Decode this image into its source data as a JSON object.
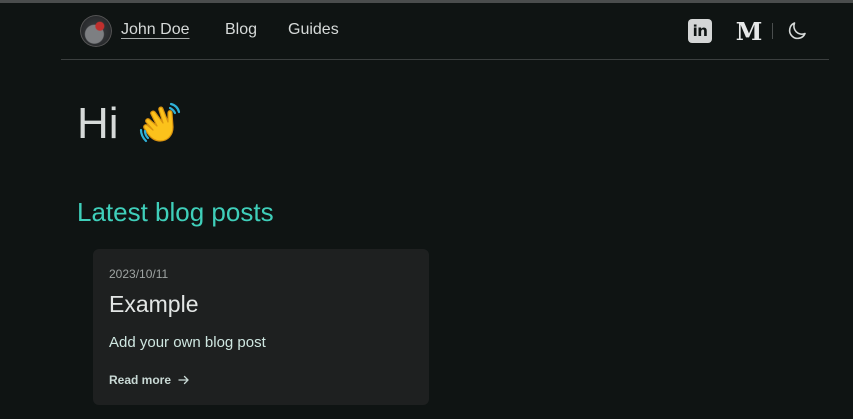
{
  "nav": {
    "name": "John Doe",
    "links": [
      {
        "label": "Blog"
      },
      {
        "label": "Guides"
      }
    ],
    "icons": [
      "linkedin-icon",
      "medium-icon",
      "moon-icon"
    ],
    "linkedin_glyph": "in",
    "medium_glyph": "M"
  },
  "hero": {
    "greeting": "Hi",
    "emoji": "waving-hand"
  },
  "section": {
    "title": "Latest blog posts"
  },
  "posts": [
    {
      "date": "2023/10/11",
      "title": "Example",
      "excerpt": "Add your own blog post",
      "read_more": "Read more"
    }
  ],
  "colors": {
    "background": "#0f1413",
    "accent": "#3fcfba",
    "card": "#1e2020",
    "text": "#d6dad9"
  }
}
